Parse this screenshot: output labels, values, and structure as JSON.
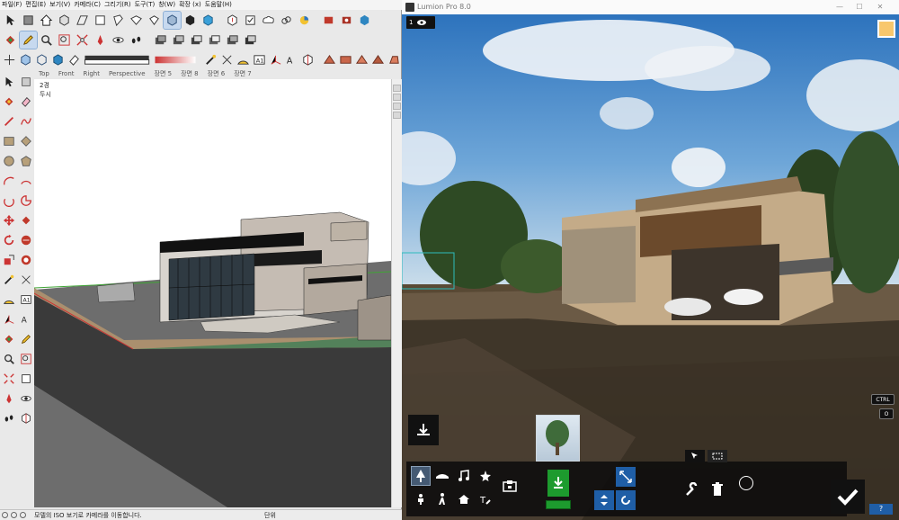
{
  "sketchup": {
    "menu": [
      "파일(F)",
      "편집(E)",
      "보기(V)",
      "카메라(C)",
      "그리기(R)",
      "도구(T)",
      "창(W)",
      "확장 (x)",
      "도움말(H)"
    ],
    "scene_tabs": [
      "Top",
      "Front",
      "Right",
      "Perspective",
      "장면 5",
      "장면 8",
      "장면 6",
      "장면 7"
    ],
    "scene_labels": [
      "2경",
      "두시"
    ],
    "status_message": "모델의 ISO 보기로 카메라를 이동합니다.",
    "status_unit": "단위",
    "accent_color": "#3fa535"
  },
  "lumion": {
    "window_title": "Lumion Pro 8.0",
    "title_controls": [
      "—",
      "☐",
      "✕"
    ],
    "top_badge": "1",
    "key_badges": [
      "CTRL",
      "O"
    ],
    "help_label": "?",
    "accent_color": "#1d9b2e",
    "sun_color": "#f8c76d"
  }
}
